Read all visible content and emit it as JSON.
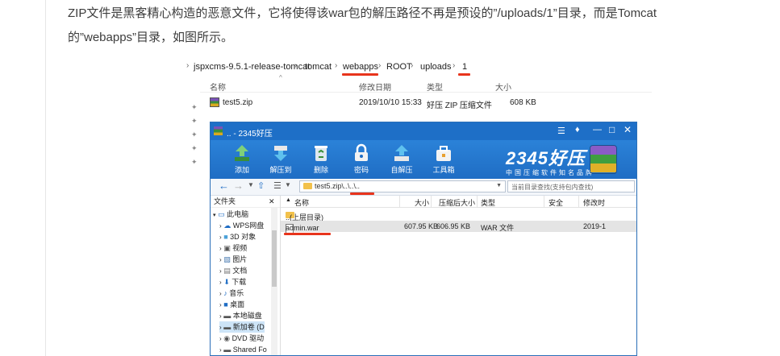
{
  "article": {
    "line1": "ZIP文件是黑客精心构造的恶意文件，它将使得该war包的解压路径不再是预设的”/uploads/1”目录，而是Tomcat",
    "line2": "的”webapps”目录，如图所示。"
  },
  "explorer": {
    "breadcrumb": [
      "jspxcms-9.5.1-release-tomcat",
      "tomcat",
      "webapps",
      "ROOT",
      "uploads",
      "1"
    ],
    "columns": {
      "name": "名称",
      "modified": "修改日期",
      "type": "类型",
      "size": "大小"
    },
    "file": {
      "name": "test5.zip",
      "modified": "2019/10/10 15:33",
      "type": "好压 ZIP 压缩文件",
      "size": "608 KB"
    }
  },
  "haozip": {
    "title": ".. - 2345好压",
    "toolbar": [
      "添加",
      "解压到",
      "删除",
      "密码",
      "自解压",
      "工具箱"
    ],
    "brand": "2345好压",
    "slogan": "中国压缩软件知名品牌",
    "path": "test5.zip\\..\\..\\..",
    "search_placeholder": "当前目录查找(支持包内查找)",
    "left_header": "文件夹",
    "tree": [
      "此电脑",
      "WPS网盘",
      "3D 对象",
      "视频",
      "图片",
      "文档",
      "下载",
      "音乐",
      "桌面",
      "本地磁盘",
      "新加卷 (D",
      "DVD 驱动",
      "Shared Fo"
    ],
    "columns": {
      "name": "名称",
      "size": "大小",
      "packed": "压缩后大小",
      "type": "类型",
      "security": "安全",
      "modified": "修改时"
    },
    "rows": [
      {
        "name": "..(上层目录)"
      },
      {
        "name": "admin.war",
        "size": "607.95 KB",
        "packed": "606.95 KB",
        "type": "WAR 文件",
        "modified": "2019-1"
      }
    ]
  },
  "colors": {
    "accent_red": "#e8341c",
    "toolbar_blue": "#1f6dc4"
  }
}
